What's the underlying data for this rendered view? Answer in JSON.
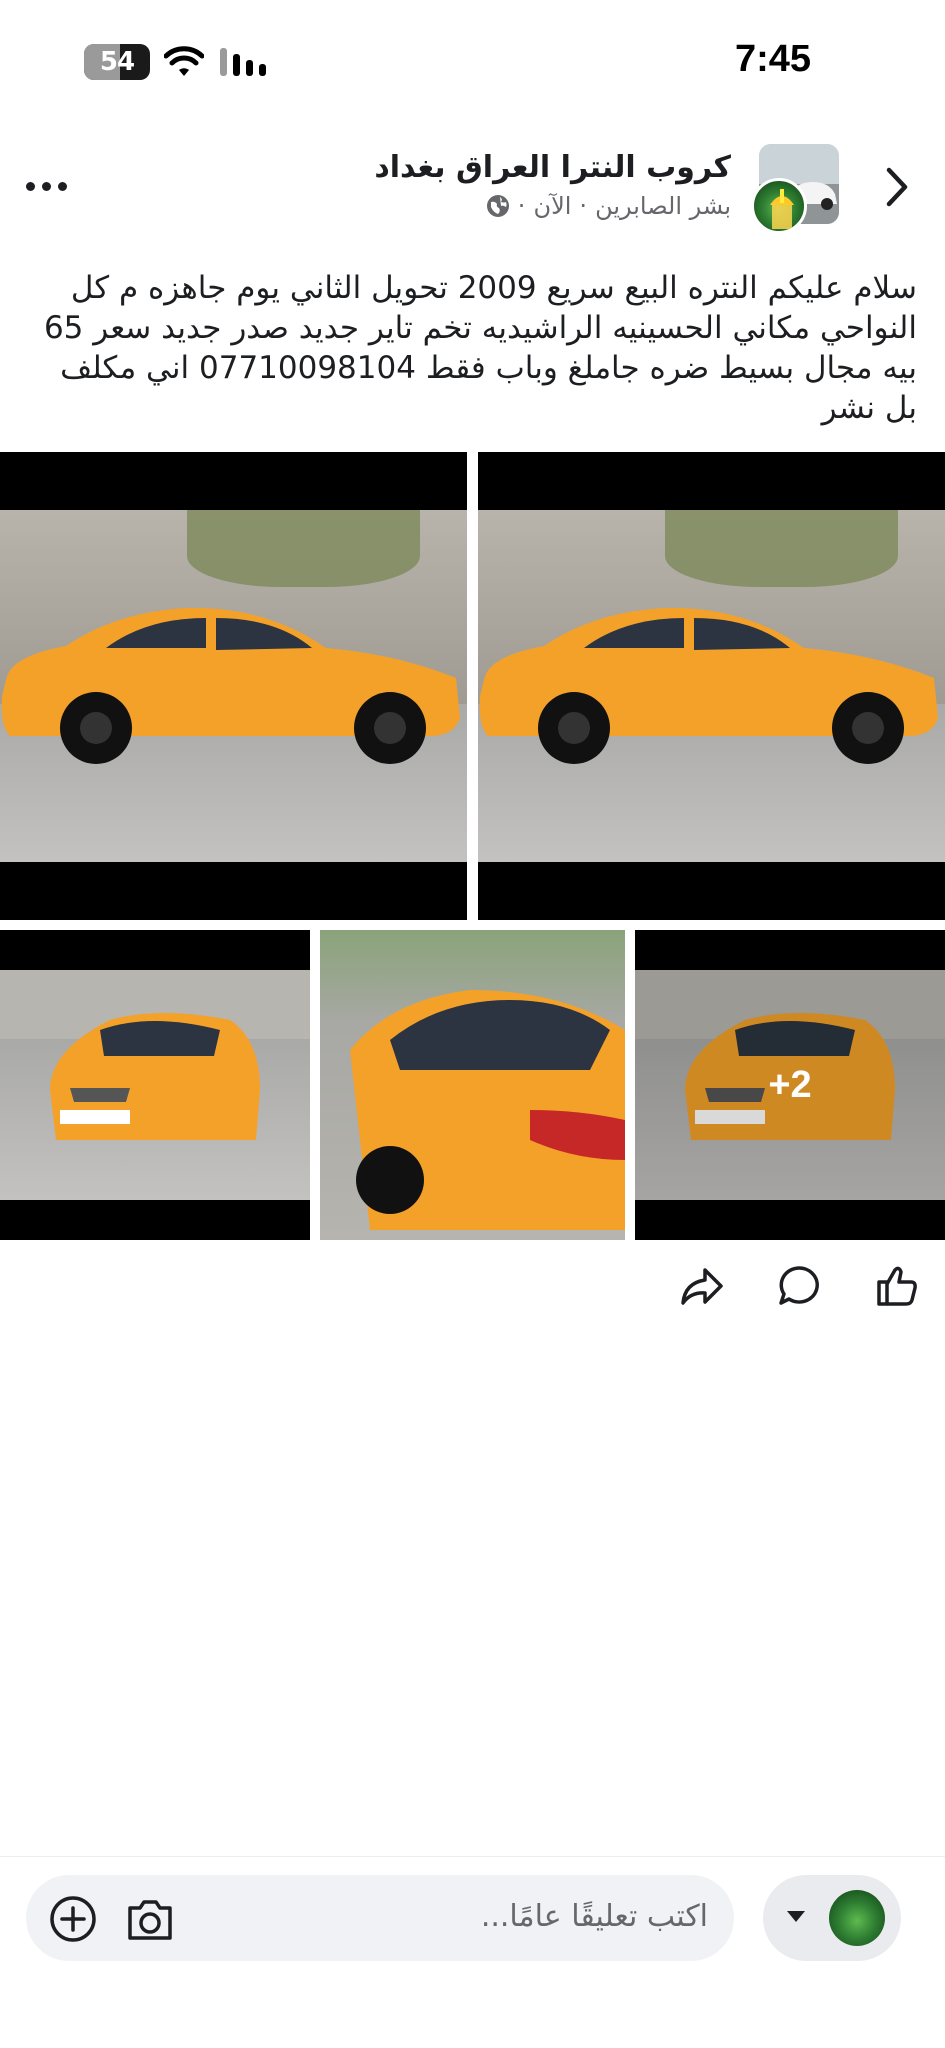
{
  "status_bar": {
    "time": "7:45",
    "battery": "54",
    "battery_level": 0.54
  },
  "header": {
    "group_name": "كروب النترا العراق بغداد",
    "author": "بشر الصابرين",
    "time": "الآن",
    "separator": "·",
    "privacy_icon": "globe-icon"
  },
  "post": {
    "text": "سلام عليكم النتره البيع سريع 2009 تحويل  الثاني يوم جاهزه م كل النواحي مكاني  الحسينيه الراشيديه تخم تاير جديد صدر جديد سعر 65 بيه مجال بسيط ضره جاملغ وباب فقط 07710098104 اني مكلف بل نشر"
  },
  "photos": {
    "more_count": "+2",
    "car_color": "#f4a12a"
  },
  "actions": [
    "like-icon",
    "comment-icon",
    "share-icon"
  ],
  "composer": {
    "placeholder": "اكتب تعليقًا عامًا..."
  }
}
